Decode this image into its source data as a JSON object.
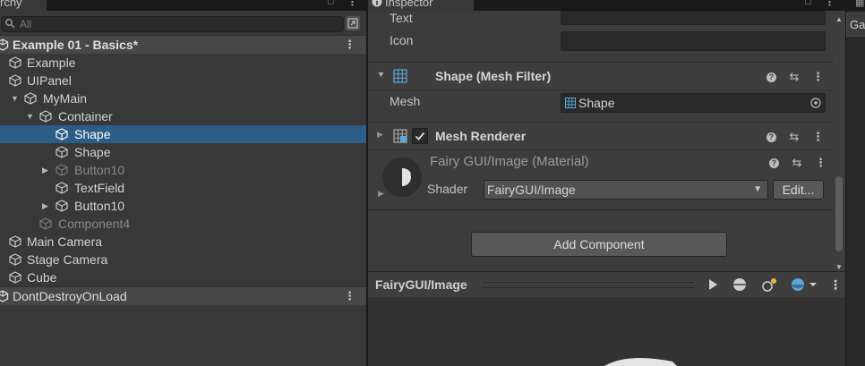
{
  "hierarchy": {
    "tab_label": "rchy",
    "search_placeholder": "All",
    "rows": [
      {
        "label": "Example 01 - Basics*"
      },
      {
        "label": "Example"
      },
      {
        "label": "UIPanel"
      },
      {
        "label": "MyMain"
      },
      {
        "label": "Container"
      },
      {
        "label": "Shape"
      },
      {
        "label": "Shape"
      },
      {
        "label": "Button10"
      },
      {
        "label": "TextField"
      },
      {
        "label": "Button10"
      },
      {
        "label": "Component4"
      },
      {
        "label": "Main Camera"
      },
      {
        "label": "Stage Camera"
      },
      {
        "label": "Cube"
      },
      {
        "label": "DontDestroyOnLoad"
      }
    ]
  },
  "inspector": {
    "tab_label": "Inspector",
    "text_label": "Text",
    "text_value": "",
    "icon_label": "Icon",
    "icon_value": "",
    "mesh_filter": {
      "title": "Shape (Mesh Filter)",
      "mesh_label": "Mesh",
      "mesh_value": "Shape"
    },
    "mesh_renderer": {
      "title": "Mesh Renderer",
      "enabled": true
    },
    "material": {
      "title": "Fairy GUI/Image (Material)",
      "shader_label": "Shader",
      "shader_value": "FairyGUI/Image",
      "edit_label": "Edit..."
    },
    "add_component_label": "Add Component",
    "preview": {
      "title": "FairyGUI/Image"
    }
  },
  "right_panel": {
    "tab_label": "Ga"
  },
  "colors": {
    "selection": "#2c5d87",
    "panel": "#383838",
    "inspector": "#3c3c3c"
  }
}
